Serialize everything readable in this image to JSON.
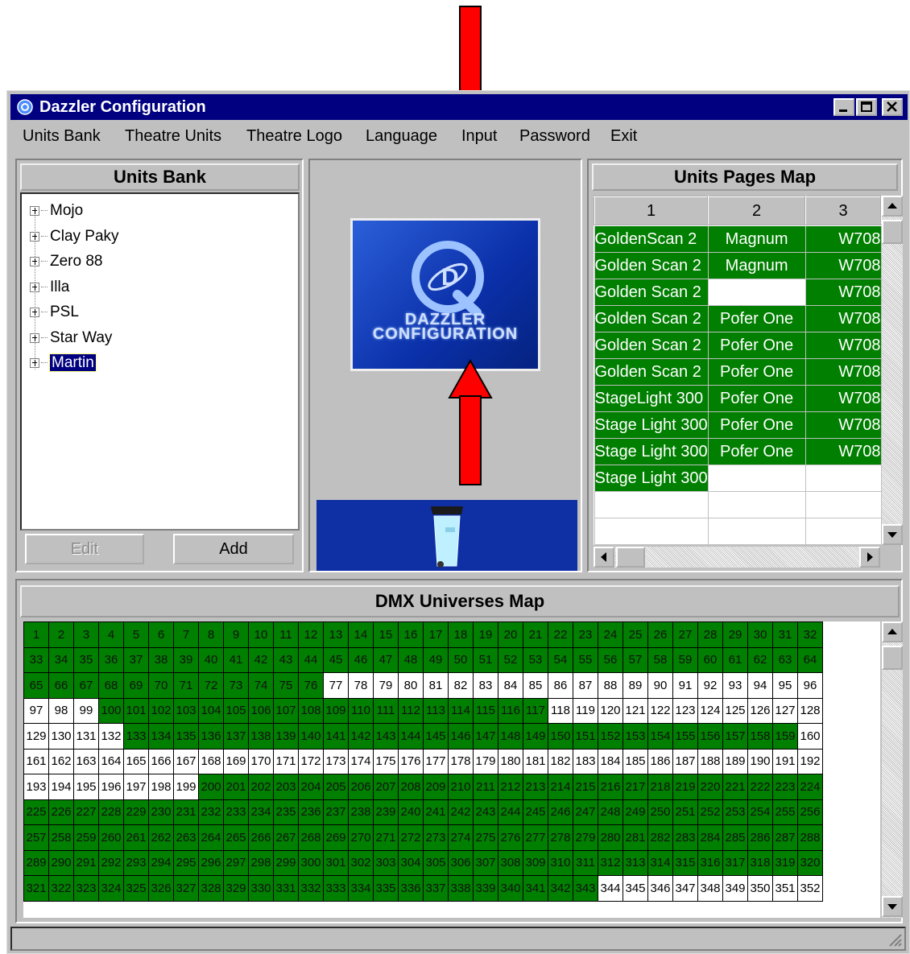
{
  "window": {
    "title": "Dazzler Configuration"
  },
  "menu": [
    "Units Bank",
    "Theatre Units",
    "Theatre Logo",
    "Language",
    "Input",
    "Password",
    "Exit"
  ],
  "units_bank": {
    "header": "Units Bank",
    "items": [
      "Mojo",
      "Clay Paky",
      "Zero 88",
      "Illa",
      "PSL",
      "Star Way",
      "Martin"
    ],
    "selected": "Martin",
    "edit_label": "Edit",
    "add_label": "Add"
  },
  "logo": {
    "line1": "DAZZLER",
    "line2": "CONFIGURATION"
  },
  "units_pages_map": {
    "header": "Units Pages Map",
    "columns": [
      "1",
      "2",
      "3"
    ],
    "rows": [
      [
        "GoldenScan 2",
        "Magnum",
        "W708"
      ],
      [
        "Golden Scan 2",
        "Magnum",
        "W708"
      ],
      [
        "Golden Scan 2",
        "",
        "W708"
      ],
      [
        "Golden Scan 2",
        "Pofer One",
        "W708"
      ],
      [
        "Golden Scan 2",
        "Pofer One",
        "W708"
      ],
      [
        "Golden Scan 2",
        "Pofer One",
        "W708"
      ],
      [
        "StageLight 300",
        "Pofer One",
        "W708"
      ],
      [
        "Stage Light 300",
        "Pofer One",
        "W708"
      ],
      [
        "Stage Light 300",
        "Pofer One",
        "W708"
      ],
      [
        "Stage Light 300",
        "",
        ""
      ],
      [
        "",
        "",
        ""
      ],
      [
        "",
        "",
        ""
      ]
    ]
  },
  "dmx": {
    "header": "DMX Universes Map",
    "columns": 32,
    "rows": 11,
    "green_ranges": [
      [
        1,
        76
      ],
      [
        100,
        117
      ],
      [
        133,
        159
      ],
      [
        200,
        343
      ]
    ],
    "colors": {
      "assigned": "#007f00",
      "free": "#ffffff"
    }
  }
}
